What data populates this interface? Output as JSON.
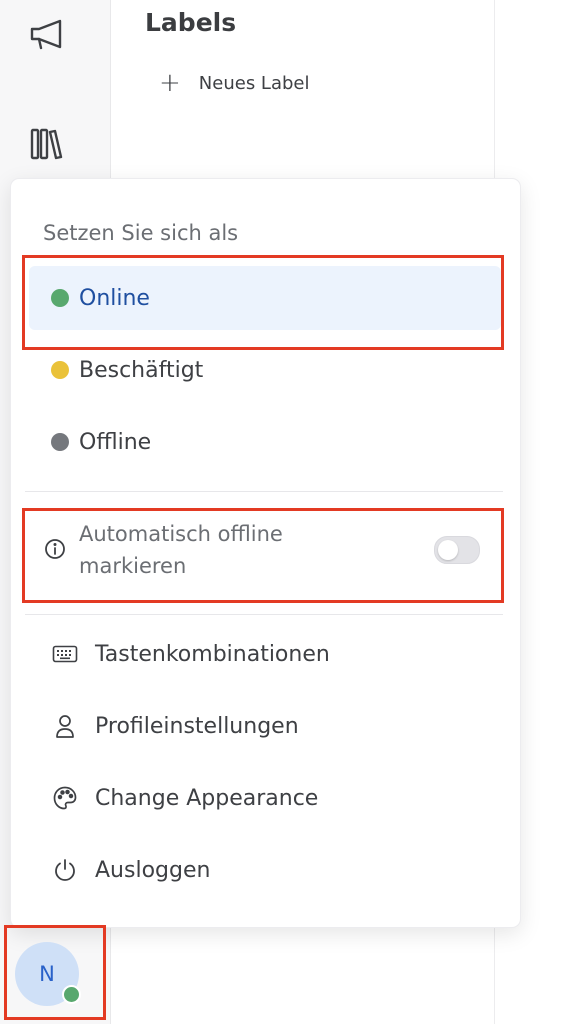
{
  "sidebar": {
    "icons": [
      "megaphone-icon",
      "library-icon"
    ]
  },
  "panel": {
    "title": "Labels",
    "new_label": "Neues Label"
  },
  "status_menu": {
    "heading": "Setzen Sie sich als",
    "statuses": [
      {
        "label": "Online",
        "color": "#58a86e",
        "active": true
      },
      {
        "label": "Beschäftigt",
        "color": "#eac23a",
        "active": false
      },
      {
        "label": "Offline",
        "color": "#75787d",
        "active": false
      }
    ],
    "auto_offline": {
      "label": "Automatisch offline markieren",
      "enabled": false
    },
    "actions": [
      {
        "label": "Tastenkombinationen",
        "icon": "keyboard-icon"
      },
      {
        "label": "Profileinstellungen",
        "icon": "user-icon"
      },
      {
        "label": "Change Appearance",
        "icon": "palette-icon"
      },
      {
        "label": "Ausloggen",
        "icon": "power-icon"
      }
    ]
  },
  "user": {
    "avatar_initial": "N",
    "presence_color": "#58a86e"
  },
  "colors": {
    "accent": "#1f4fa0",
    "highlight": "#e33a23"
  }
}
